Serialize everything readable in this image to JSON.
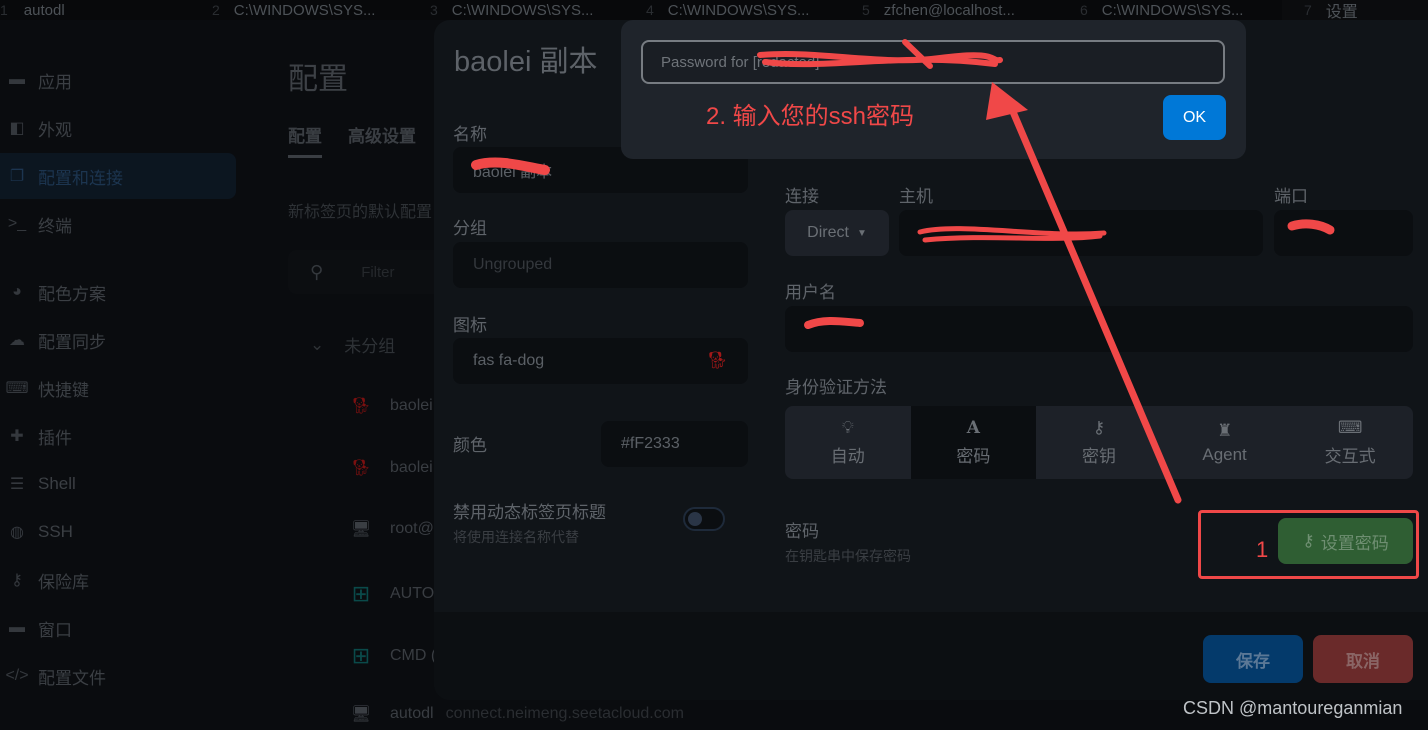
{
  "tabs": [
    {
      "num": "1",
      "label": "autodl"
    },
    {
      "num": "2",
      "label": "C:\\WINDOWS\\SYS..."
    },
    {
      "num": "3",
      "label": "C:\\WINDOWS\\SYS..."
    },
    {
      "num": "4",
      "label": "C:\\WINDOWS\\SYS..."
    },
    {
      "num": "5",
      "label": "zfchen@localhost..."
    },
    {
      "num": "6",
      "label": "C:\\WINDOWS\\SYS..."
    },
    {
      "num": "7",
      "label": "设置"
    }
  ],
  "sidebar": {
    "items": [
      {
        "label": "应用",
        "icon": "window-icon"
      },
      {
        "label": "外观",
        "icon": "swatchbook-icon"
      },
      {
        "label": "配置和连接",
        "icon": "clone-icon",
        "active": true
      },
      {
        "label": "终端",
        "icon": "terminal-icon"
      },
      {
        "label": "配色方案",
        "icon": "palette-icon"
      },
      {
        "label": "配置同步",
        "icon": "cloud-icon"
      },
      {
        "label": "快捷键",
        "icon": "keyboard-icon"
      },
      {
        "label": "插件",
        "icon": "puzzle-icon"
      },
      {
        "label": "Shell",
        "icon": "list-icon"
      },
      {
        "label": "SSH",
        "icon": "globe-icon"
      },
      {
        "label": "保险库",
        "icon": "key-icon"
      },
      {
        "label": "窗口",
        "icon": "window-icon"
      },
      {
        "label": "配置文件",
        "icon": "code-icon"
      }
    ]
  },
  "config_page": {
    "title": "配置",
    "tabs": [
      "配置",
      "高级设置"
    ],
    "description": "新标签页的默认配置",
    "filter_placeholder": "Filter",
    "group_label": "未分组",
    "profiles": [
      {
        "name": "baolei",
        "icon": "dog-icon",
        "icon_color": "#7a1010"
      },
      {
        "name": "baolei",
        "icon": "dog-icon",
        "icon_color": "#7a1010"
      },
      {
        "name": "root@",
        "icon": "desktop-icon"
      },
      {
        "name": "AUTO",
        "icon": "windows-icon",
        "icon_color": "#0a4a4a"
      },
      {
        "name": "CMD (",
        "icon": "windows-icon",
        "icon_color": "#0a4a4a"
      },
      {
        "name": "autodl",
        "sub": "connect.neimeng.seetacloud.com",
        "icon": "desktop-icon"
      }
    ]
  },
  "edit_profile": {
    "title": "baolei 副本",
    "name_label": "名称",
    "name_value": "baolei 副本",
    "group_label": "分组",
    "group_placeholder": "Ungrouped",
    "icon_label": "图标",
    "icon_value": "fas fa-dog",
    "color_label": "颜色",
    "color_value": "#fF2333",
    "disable_dynamic_title_label": "禁用动态标签页标题",
    "disable_dynamic_title_hint": "将使用连接名称代替",
    "disable_dynamic_title_on": false,
    "connection_label": "连接",
    "connection_value": "Direct",
    "host_label": "主机",
    "host_value": "[redacted]",
    "port_label": "端口",
    "port_value": "[redacted]",
    "username_label": "用户名",
    "username_value": "[redacted]",
    "auth_label": "身份验证方法",
    "auth_options": [
      {
        "label": "自动",
        "icon": "lightbulb-icon"
      },
      {
        "label": "密码",
        "icon": "font-icon",
        "selected": true
      },
      {
        "label": "密钥",
        "icon": "key-icon"
      },
      {
        "label": "Agent",
        "icon": "user-secret-icon"
      },
      {
        "label": "交互式",
        "icon": "keyboard-icon"
      }
    ],
    "password_label": "密码",
    "password_hint": "在钥匙串中保存密码",
    "set_password_button": "设置密码",
    "save_button": "保存",
    "cancel_button": "取消"
  },
  "password_prompt": {
    "placeholder": "Password for [redacted]",
    "ok_button": "OK"
  },
  "annotations": {
    "step1": "1",
    "step2": "2. 输入您的ssh密码",
    "color": "#f04848"
  },
  "watermark": "CSDN @mantoureganmian"
}
